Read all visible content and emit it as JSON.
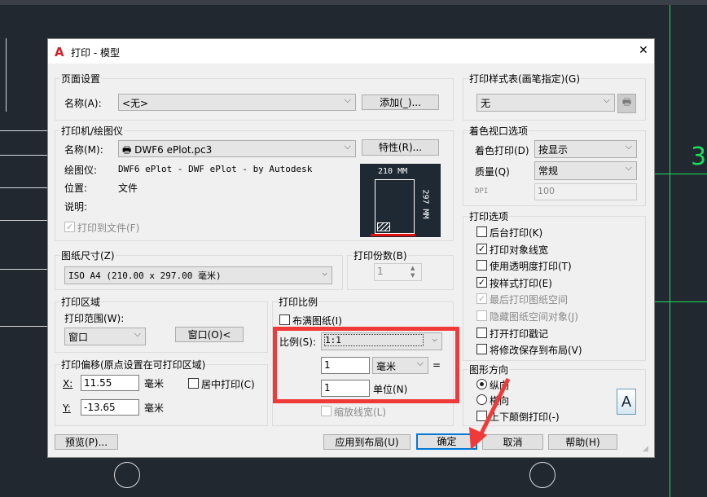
{
  "window": {
    "title": "打印 - 模型",
    "close": "✕"
  },
  "page_setup": {
    "group": "页面设置",
    "name_label": "名称(A):",
    "name_value": "<无>",
    "add_button": "添加(_)..."
  },
  "printer": {
    "group": "打印机/绘图仪",
    "name_label": "名称(M):",
    "name_value": "DWF6 ePlot.pc3",
    "properties_button": "特性(R)...",
    "plotter_label": "绘图仪:",
    "plotter_value": "DWF6 ePlot - DWF ePlot - by Autodesk",
    "location_label": "位置:",
    "location_value": "文件",
    "description_label": "说明:",
    "print_to_file": "打印到文件(F)",
    "preview_width": "210 MM",
    "preview_height": "297 MM"
  },
  "paper_size": {
    "group": "图纸尺寸(Z)",
    "value": "ISO A4 (210.00 x 297.00 毫米)"
  },
  "copies": {
    "group": "打印份数(B)",
    "value": "1"
  },
  "plot_area": {
    "group": "打印区域",
    "range_label": "打印范围(W):",
    "range_value": "窗口",
    "window_button": "窗口(O)<"
  },
  "plot_offset": {
    "group": "打印偏移(原点设置在可打印区域)",
    "x_label": "X:",
    "x_value": "11.55",
    "y_label": "Y:",
    "y_value": "-13.65",
    "unit": "毫米",
    "center": "居中打印(C)"
  },
  "plot_scale": {
    "group": "打印比例",
    "fit": "布满图纸(I)",
    "scale_label": "比例(S):",
    "scale_value": "1:1",
    "value1": "1",
    "unit_value": "毫米",
    "equals": "=",
    "value2": "1",
    "units_label": "单位(N)",
    "scale_lineweights": "缩放线宽(L)"
  },
  "style_table": {
    "group": "打印样式表(画笔指定)(G)",
    "value": "无"
  },
  "shaded": {
    "group": "着色视口选项",
    "shade_label": "着色打印(D)",
    "shade_value": "按显示",
    "quality_label": "质量(Q)",
    "quality_value": "常规",
    "dpi_label": "DPI",
    "dpi_value": "100"
  },
  "options": {
    "group": "打印选项",
    "items": [
      {
        "label": "后台打印(K)",
        "checked": false,
        "disabled": false
      },
      {
        "label": "打印对象线宽",
        "checked": true,
        "disabled": false
      },
      {
        "label": "使用透明度打印(T)",
        "checked": false,
        "disabled": false
      },
      {
        "label": "按样式打印(E)",
        "checked": true,
        "disabled": false
      },
      {
        "label": "最后打印图纸空间",
        "checked": true,
        "disabled": true
      },
      {
        "label": "隐藏图纸空间对象(J)",
        "checked": false,
        "disabled": true
      },
      {
        "label": "打开打印戳记",
        "checked": false,
        "disabled": false
      },
      {
        "label": "将修改保存到布局(V)",
        "checked": false,
        "disabled": false
      }
    ]
  },
  "orientation": {
    "group": "图形方向",
    "portrait": "纵向",
    "landscape": "横向",
    "upside_down": "上下颠倒打印(-)",
    "icon_letter": "A"
  },
  "buttons": {
    "preview": "预览(P)...",
    "apply": "应用到布局(U)",
    "ok": "确定",
    "cancel": "取消",
    "help": "帮助(H)"
  },
  "cad": {
    "dim_text": "3"
  },
  "colors": {
    "highlight": "#f03a3a",
    "accent": "#0078d7",
    "cad_green": "#19e05a"
  }
}
